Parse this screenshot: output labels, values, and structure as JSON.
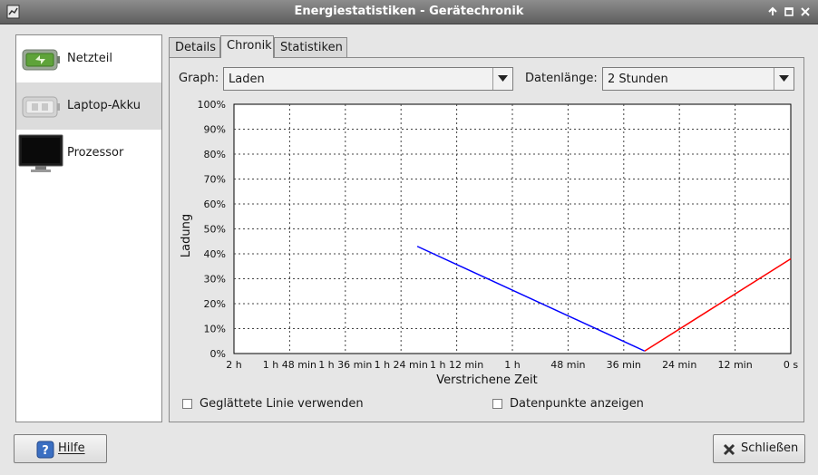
{
  "window": {
    "title": "Energiestatistiken - Gerätechronik"
  },
  "sidebar": {
    "items": [
      {
        "label": "Netzteil",
        "icon": "power-supply-icon",
        "selected": false
      },
      {
        "label": "Laptop-Akku",
        "icon": "laptop-battery-icon",
        "selected": true
      },
      {
        "label": "Prozessor",
        "icon": "monitor-icon",
        "selected": false
      }
    ]
  },
  "tabs": [
    {
      "label": "Details",
      "active": false
    },
    {
      "label": "Chronik",
      "active": true
    },
    {
      "label": "Statistiken",
      "active": false
    }
  ],
  "controls": {
    "graph_label": "Graph:",
    "graph_value": "Laden",
    "length_label": "Datenlänge:",
    "length_value": "2 Stunden"
  },
  "chart_data": {
    "type": "line",
    "ylabel": "Ladung",
    "xlabel": "Verstrichene Zeit",
    "x_unit": "minutes elapsed (0 = 2 h)",
    "ylim": [
      0,
      100
    ],
    "xlim": [
      0,
      120
    ],
    "y_ticks": [
      "0%",
      "10%",
      "20%",
      "30%",
      "40%",
      "50%",
      "60%",
      "70%",
      "80%",
      "90%",
      "100%"
    ],
    "x_ticks": [
      "2 h",
      "1 h 48 min",
      "1 h 36 min",
      "1 h 24 min",
      "1 h 12 min",
      "1 h",
      "48 min",
      "36 min",
      "24 min",
      "12 min",
      "0 s"
    ],
    "grid": true,
    "series": [
      {
        "color": "#0000ff",
        "x": [
          39.5,
          88.5
        ],
        "y": [
          43,
          1
        ]
      },
      {
        "color": "#ff0000",
        "x": [
          88.5,
          120
        ],
        "y": [
          1,
          38
        ]
      }
    ]
  },
  "options": {
    "smooth_label": "Geglättete Linie verwenden",
    "smooth_checked": false,
    "points_label": "Datenpunkte anzeigen",
    "points_checked": false
  },
  "buttons": {
    "help_label": "Hilfe",
    "close_label": "Schließen"
  }
}
